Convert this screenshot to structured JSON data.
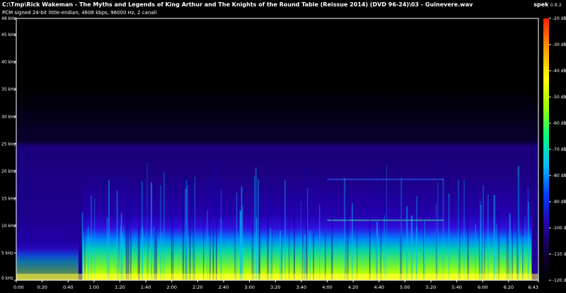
{
  "window": {
    "title": "C:\\Tmp\\Rick Wakeman - The Myths and Legends of King Arthur and The Knights of the Round Table (Reissue 2014) (DVD 96-24)\\03 - Guinevere.wav",
    "subtitle": "PCM signed 24-bit little-endian, 4608 kbps, 96000 Hz, 2 canali",
    "app_name": "spek",
    "app_version": "0.8.2"
  },
  "colors": {
    "background": "#000000",
    "axis": "#ffffff",
    "spectrum_low": "#000000",
    "spectrum_mid": "#2000c0",
    "spectrum_high": "#ffff00"
  },
  "chart_data": {
    "type": "heatmap",
    "title": "",
    "xlabel": "",
    "ylabel": "",
    "x_unit": "time (m:ss)",
    "y_unit": "kHz",
    "x_range_seconds": [
      0,
      403
    ],
    "ylim_khz": [
      0,
      48
    ],
    "x_ticks": [
      "0:00",
      "0:20",
      "0:40",
      "1:00",
      "1:20",
      "1:40",
      "2:00",
      "2:20",
      "2:40",
      "3:00",
      "3:20",
      "3:40",
      "4:00",
      "4:20",
      "4:40",
      "5:00",
      "5:20",
      "5:40",
      "6:00",
      "6:20",
      "6:43"
    ],
    "x_tick_seconds": [
      0,
      20,
      40,
      60,
      80,
      100,
      120,
      140,
      160,
      180,
      200,
      220,
      240,
      260,
      280,
      300,
      320,
      340,
      360,
      380,
      403
    ],
    "y_ticks": [
      "0 kHz",
      "5 kHz",
      "10 kHz",
      "15 kHz",
      "20 kHz",
      "25 kHz",
      "30 kHz",
      "35 kHz",
      "40 kHz",
      "45 kHz",
      "48 kHz"
    ],
    "y_tick_values": [
      0,
      5,
      10,
      15,
      20,
      25,
      30,
      35,
      40,
      45,
      48
    ],
    "colorbar": {
      "range_db": [
        -120,
        -20
      ],
      "ticks": [
        "-20 dB",
        "-30 dB",
        "-40 dB",
        "-50 dB",
        "-60 dB",
        "-70 dB",
        "-80 dB",
        "-90 dB",
        "-100 dB",
        "-110 dB",
        "-120 dB"
      ],
      "tick_values": [
        -20,
        -30,
        -40,
        -50,
        -60,
        -70,
        -80,
        -90,
        -100,
        -110,
        -120
      ],
      "colors": [
        "#000000",
        "#140040",
        "#2a00b0",
        "#0040ff",
        "#00c0ff",
        "#00ff80",
        "#a0ff00",
        "#ffff00",
        "#ffa000",
        "#ff2000"
      ]
    },
    "content_top_khz": 35,
    "bands_khz": [
      18.5,
      11
    ]
  }
}
